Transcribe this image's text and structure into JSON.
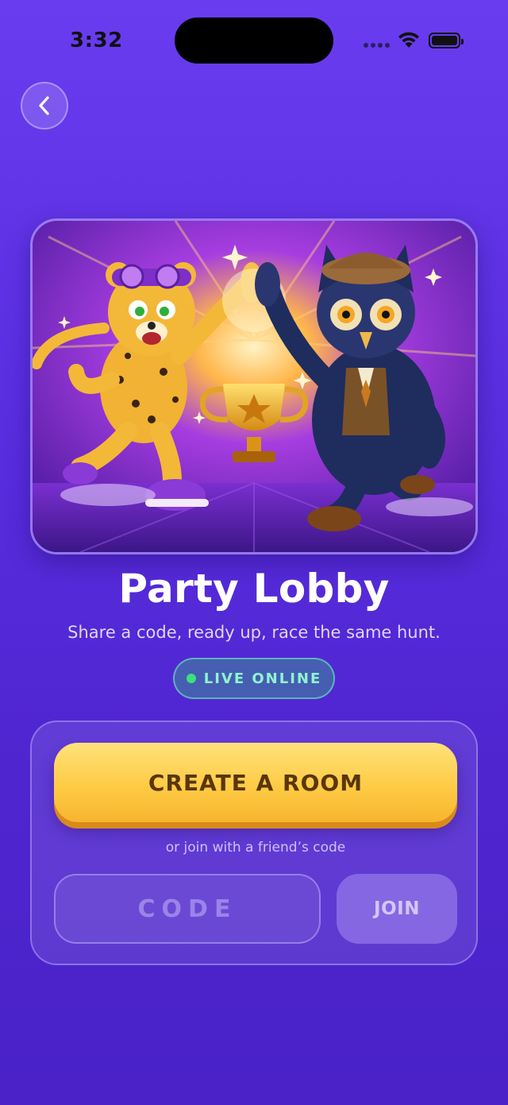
{
  "status_bar": {
    "time": "3:32"
  },
  "back_icon": "chevron-left-icon",
  "hero": {
    "description_icon": "cheetah-owl-trophy-illustration"
  },
  "title": "Party Lobby",
  "subtitle": "Share a code, ready up, race the same hunt.",
  "live_badge": {
    "label": "LIVE ONLINE",
    "dot_color": "#3ee07a"
  },
  "panel": {
    "create_label": "CREATE A ROOM",
    "or_label": "or join with a friend’s code",
    "code_placeholder": "CODE",
    "code_value": "",
    "join_label": "JOIN"
  },
  "colors": {
    "background_top": "#6a3cf0",
    "background_bottom": "#4a22c8",
    "create_button": "#fecb45",
    "create_text": "#5a3608"
  }
}
